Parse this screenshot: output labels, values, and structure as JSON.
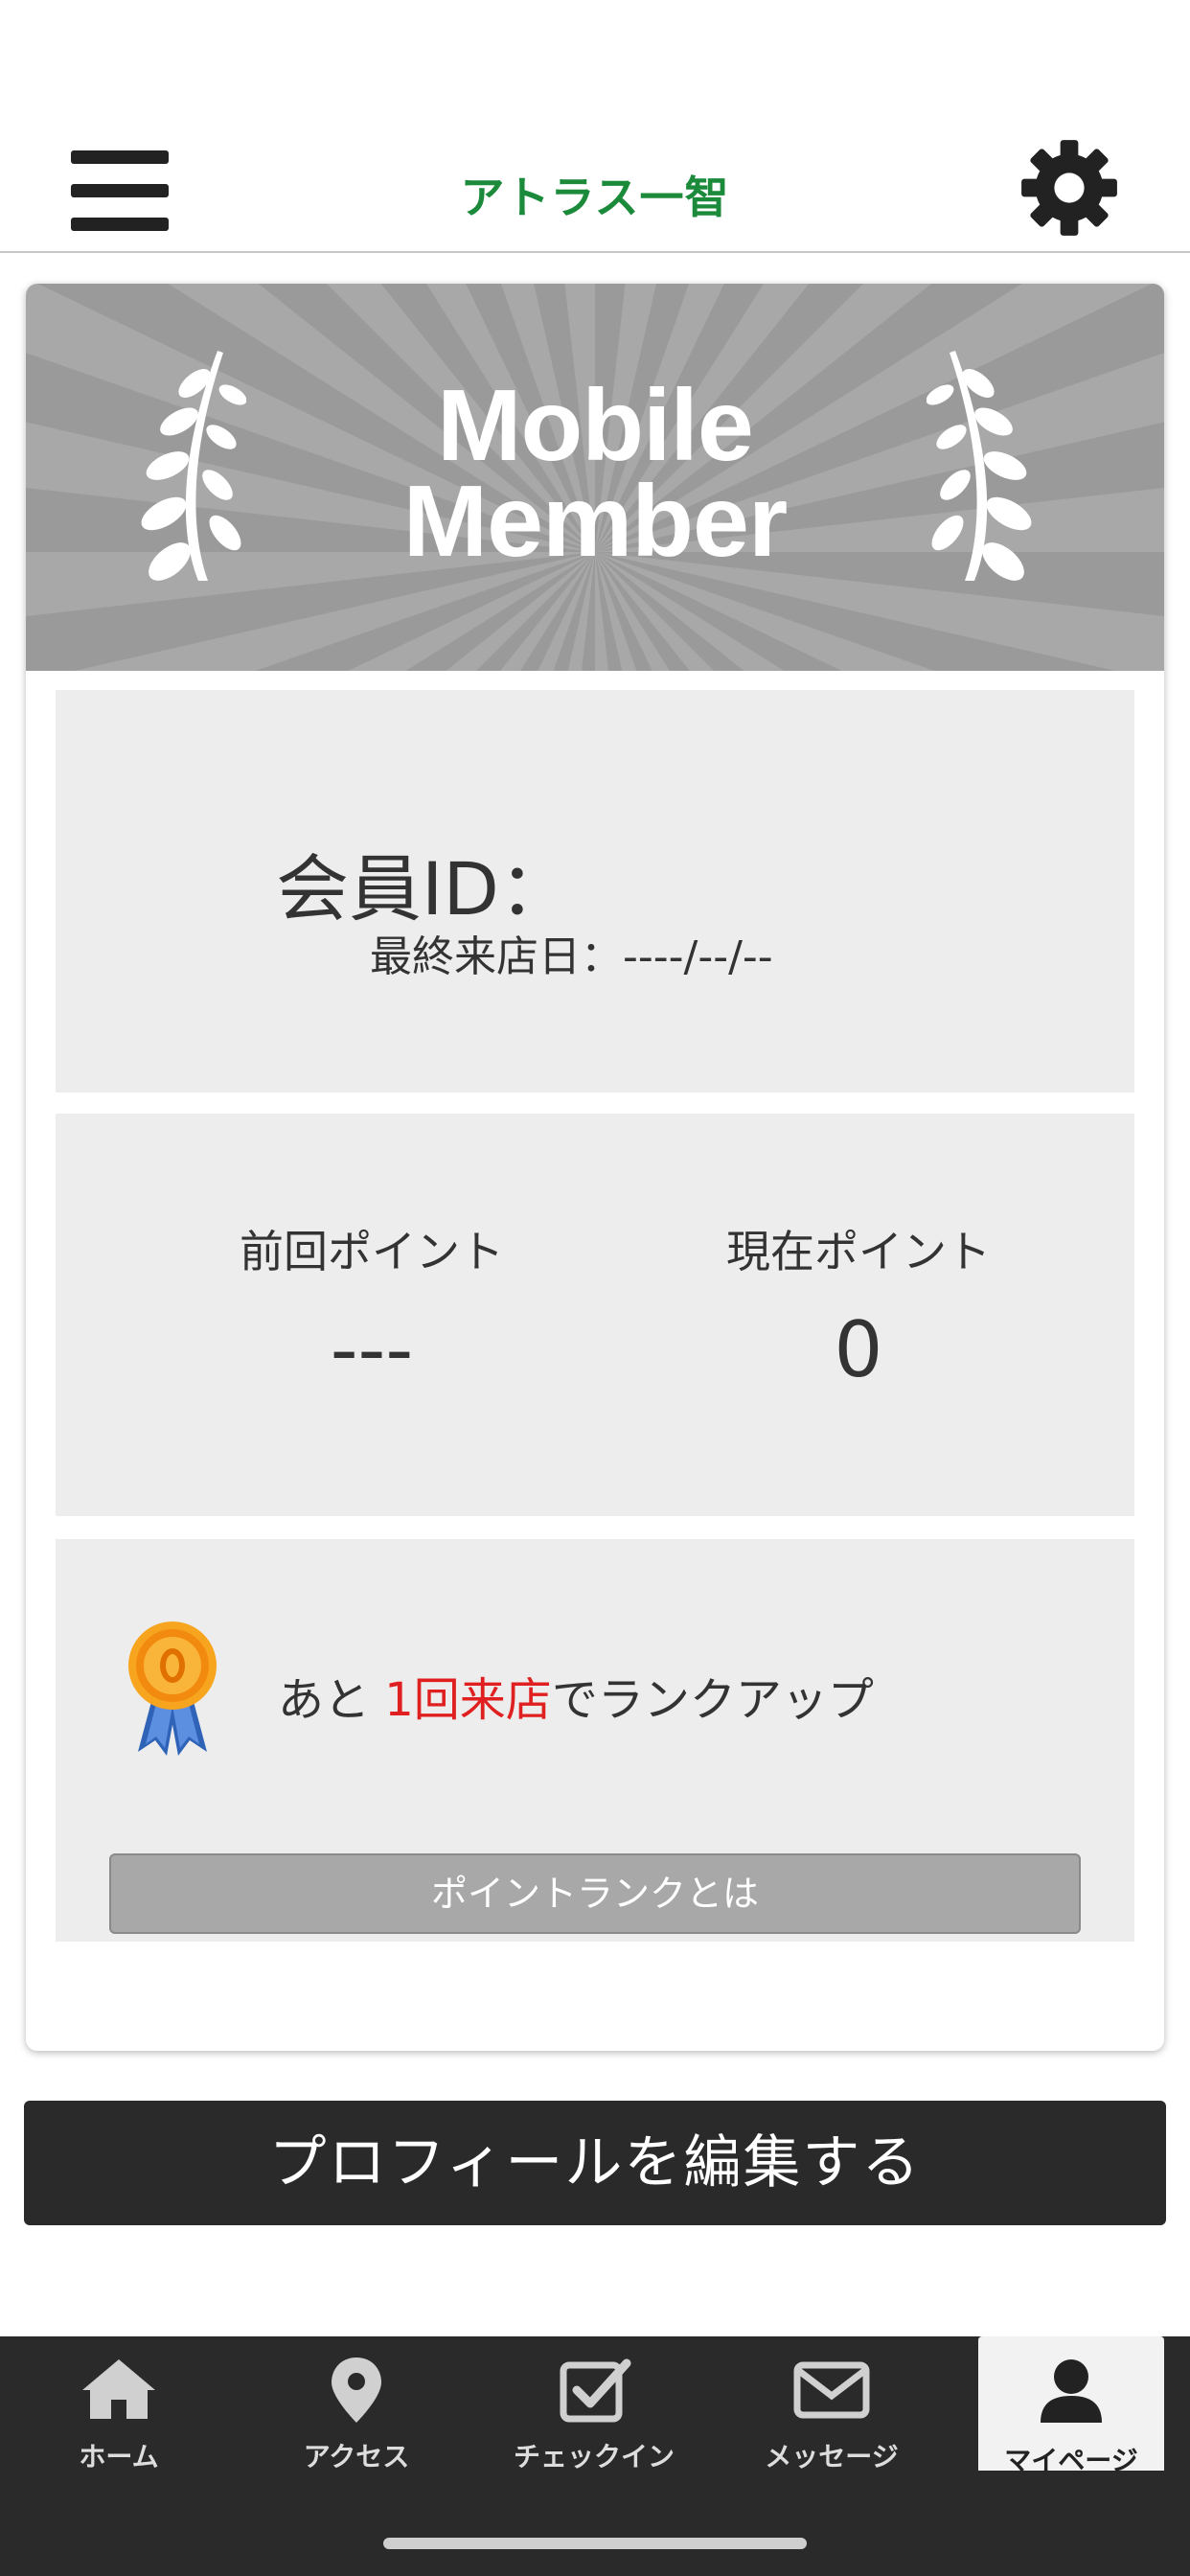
{
  "header": {
    "app_title": "アトラス一智"
  },
  "banner": {
    "line1": "Mobile",
    "line2": "Member"
  },
  "member": {
    "id_label": "会員ID：",
    "id_value": "",
    "last_visit_label": "最終来店日：",
    "last_visit_value": "----/--/--"
  },
  "points": {
    "previous_label": "前回ポイント",
    "previous_value": "---",
    "current_label": "現在ポイント",
    "current_value": "0"
  },
  "rank": {
    "msg_prefix": "あと ",
    "msg_highlight": "1回来店",
    "msg_suffix": "でランクアップ",
    "button_label": "ポイントランクとは",
    "medal_icon": "medal-icon"
  },
  "edit_profile_label": "プロフィールを編集する",
  "tabs": [
    {
      "label": "ホーム",
      "icon": "home-icon"
    },
    {
      "label": "アクセス",
      "icon": "map-pin-icon"
    },
    {
      "label": "チェックイン",
      "icon": "checkin-icon"
    },
    {
      "label": "メッセージ",
      "icon": "envelope-icon"
    },
    {
      "label": "マイページ",
      "icon": "user-icon",
      "active": true
    }
  ],
  "colors": {
    "brand_green": "#1b8a3a",
    "highlight_red": "#e02020",
    "tabbar_bg": "#2a2a2a"
  }
}
